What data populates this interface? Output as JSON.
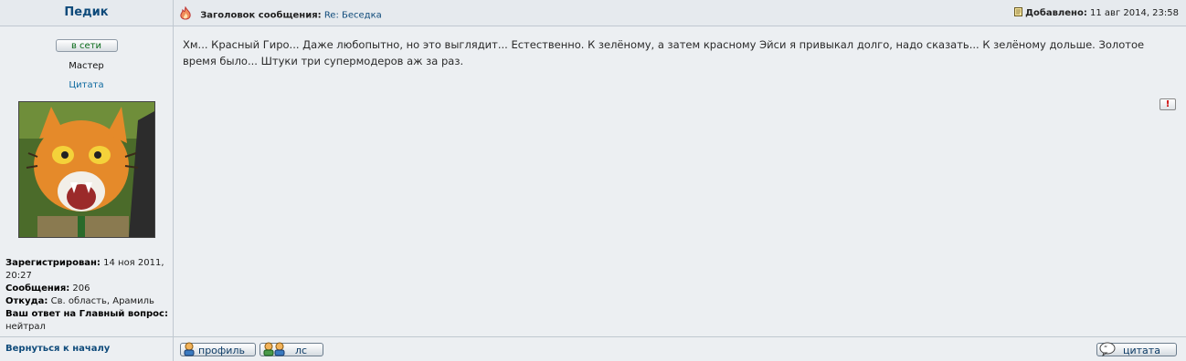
{
  "poster": {
    "username": "Педик",
    "online_label": "в сети",
    "rank": "Мастер",
    "quote_link": "Цитата",
    "details": [
      {
        "label": "Зарегистрирован:",
        "value": "14 ноя 2011, 20:27"
      },
      {
        "label": "Сообщения:",
        "value": "206"
      },
      {
        "label": "Откуда:",
        "value": "Св. область, Арамиль"
      },
      {
        "label": "Ваш ответ на Главный вопрос:",
        "value": "нейтрал"
      }
    ],
    "back_to_top": "Вернуться к началу"
  },
  "post": {
    "subject_label": "Заголовок сообщения:",
    "subject": "Re: Беседка",
    "added_label": "Добавлено:",
    "added_date": "11 авг 2014, 23:58",
    "body": "Хм... Красный Гиро... Даже любопытно, но это выглядит... Естественно. К зелёному, а затем красному Эйси я привыкал долго, надо сказать... К зелёному дольше. Золотое время было... Штуки три супермодеров аж за раз.",
    "report_label": "!"
  },
  "footer": {
    "profile_label": "профиль",
    "pm_label": "лс",
    "quote_label": "цитата"
  },
  "colors": {
    "link": "#0e4a7a",
    "online": "#0a6b1a",
    "panel": "#eceff2",
    "border": "#c0c8d0"
  },
  "icons": [
    "flame-icon",
    "post-icon",
    "report-icon",
    "profile-icon",
    "pm-icon",
    "quote-icon"
  ]
}
